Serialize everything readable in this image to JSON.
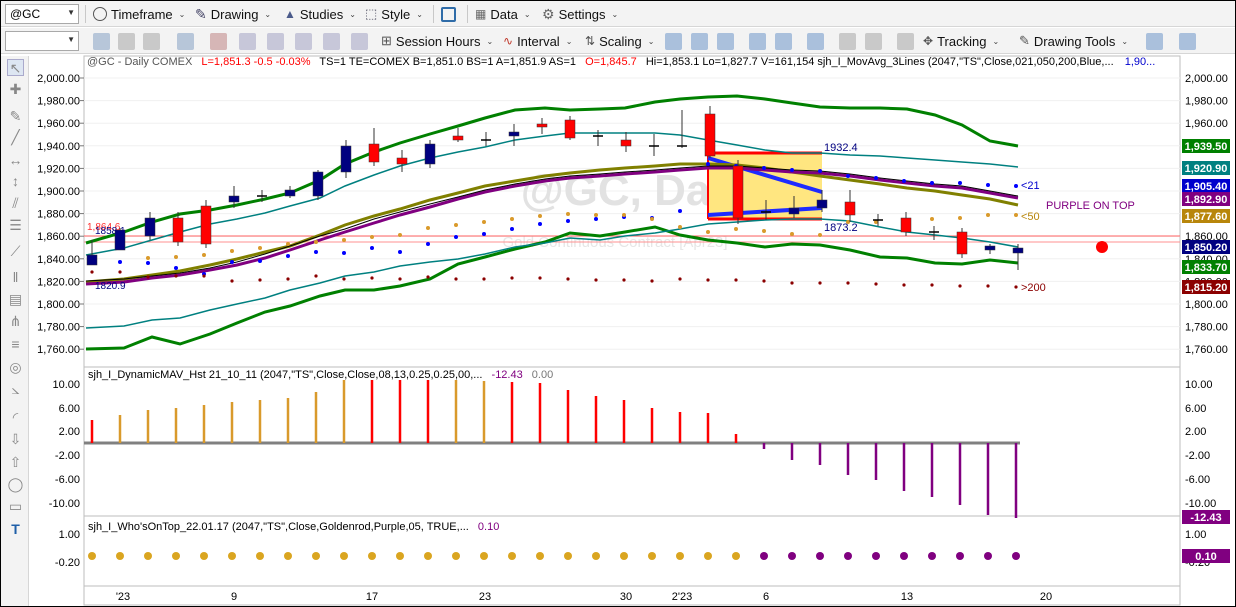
{
  "toolbar1": {
    "symbol": "@GC",
    "timeframe": "Timeframe",
    "drawing": "Drawing",
    "studies": "Studies",
    "style": "Style",
    "data": "Data",
    "settings": "Settings"
  },
  "toolbar2": {
    "session_hours": "Session Hours",
    "interval": "Interval",
    "scaling": "Scaling",
    "tracking": "Tracking",
    "drawing_tools": "Drawing Tools"
  },
  "chart": {
    "status_line": {
      "title": "@GC - Daily  COMEX",
      "change_red": "L=1,851.3  -0.5  -0.03%",
      "info1": "TS=1  TE=COMEX  B=1,851.0  BS=1  A=1,851.9  AS=1",
      "open_red": "O=1,845.7",
      "info2": "Hi=1,853.1  Lo=1,827.7  V=161,154  sjh_I_MovAvg_3Lines (2047,\"TS\",Close,021,050,200,Blue,...",
      "info3": "1,90..."
    },
    "watermark": "@GC, Daily",
    "watermark_sub": "Gold Continuous Contract [Apr23]",
    "price_axis_ticks": [
      "2,000.00",
      "1,980.00",
      "1,960.00",
      "1,940.00",
      "1,920.00",
      "1,900.00",
      "1,880.00",
      "1,860.00",
      "1,840.00",
      "1,820.00",
      "1,800.00",
      "1,780.00",
      "1,760.00"
    ],
    "price_tags": [
      {
        "label": "1,939.50",
        "color": "#008000"
      },
      {
        "label": "1,920.90",
        "color": "#008080"
      },
      {
        "label": "1,905.40",
        "color": "#0000cd"
      },
      {
        "label": "1,892.90",
        "color": "#800080"
      },
      {
        "label": "1,877.60",
        "color": "#b8860b"
      },
      {
        "label": "1,850.20",
        "color": "#000080"
      },
      {
        "label": "1,833.70",
        "color": "#008000"
      },
      {
        "label": "1,815.20",
        "color": "#8b0000"
      }
    ],
    "annotations": {
      "hi_label": "1932.4",
      "lo_label": "1873.2",
      "left_hi": "1858.1",
      "left_red": "1,864.6",
      "left_lo": "1820.9",
      "ma21": "<21",
      "ma50": "<50",
      "ma200": ">200",
      "purple_on_top": "PURPLE ON TOP"
    },
    "date_ticks": [
      "'23",
      "9",
      "17",
      "23",
      "30",
      "2'23",
      "6",
      "13",
      "20"
    ]
  },
  "sub1": {
    "title": "sjh_I_DynamicMAV_Hst 21_10_11 (2047,\"TS\",Close,Close,08,13,0.25,0.25,00,...",
    "value1": "-12.43",
    "value2": "0.00",
    "ticks": [
      "10.00",
      "6.00",
      "2.00",
      "-2.00",
      "-6.00",
      "-10.00"
    ],
    "tag": "-12.43"
  },
  "sub2": {
    "title": "sjh_I_Who'sOnTop_22.01.17 (2047,\"TS\",Close,Goldenrod,Purple,05, TRUE,...",
    "value": "0.10",
    "ticks": [
      "1.00",
      "-0.20"
    ],
    "tag": "0.10"
  },
  "colors": {
    "up_bar": "#000080",
    "down_bar": "#ff0000",
    "ma_green": "#008000",
    "ma_teal": "#008080",
    "ma_purple": "#800080",
    "ma_gold": "#808000",
    "highlight": "#ffe680"
  }
}
